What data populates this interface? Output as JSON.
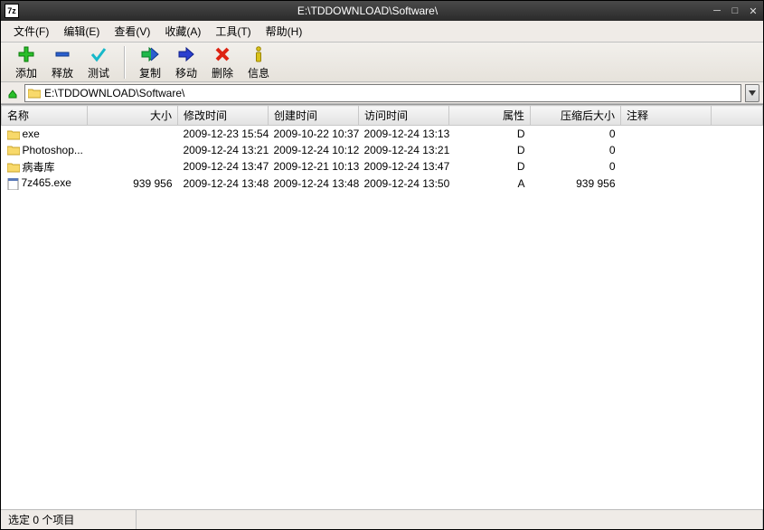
{
  "window": {
    "title": "E:\\TDDOWNLOAD\\Software\\",
    "app_icon": "7z"
  },
  "menu": {
    "file": "文件(F)",
    "edit": "编辑(E)",
    "view": "查看(V)",
    "favorites": "收藏(A)",
    "tools": "工具(T)",
    "help": "帮助(H)"
  },
  "toolbar": {
    "add": "添加",
    "extract": "释放",
    "test": "测试",
    "copy": "复制",
    "move": "移动",
    "delete": "删除",
    "info": "信息"
  },
  "path": {
    "value": "E:\\TDDOWNLOAD\\Software\\"
  },
  "columns": {
    "name": "名称",
    "size": "大小",
    "modified": "修改时间",
    "created": "创建时间",
    "accessed": "访问时间",
    "attributes": "属性",
    "packed": "压缩后大小",
    "comment": "注释"
  },
  "rows": [
    {
      "icon": "folder",
      "name": "exe",
      "size": "",
      "modified": "2009-12-23 15:54",
      "created": "2009-10-22 10:37",
      "accessed": "2009-12-24 13:13",
      "attr": "D",
      "packed": "0"
    },
    {
      "icon": "folder",
      "name": "Photoshop...",
      "size": "",
      "modified": "2009-12-24 13:21",
      "created": "2009-12-24 10:12",
      "accessed": "2009-12-24 13:21",
      "attr": "D",
      "packed": "0"
    },
    {
      "icon": "folder",
      "name": "病毒库",
      "size": "",
      "modified": "2009-12-24 13:47",
      "created": "2009-12-21 10:13",
      "accessed": "2009-12-24 13:47",
      "attr": "D",
      "packed": "0"
    },
    {
      "icon": "file",
      "name": "7z465.exe",
      "size": "939 956",
      "modified": "2009-12-24 13:48",
      "created": "2009-12-24 13:48",
      "accessed": "2009-12-24 13:50",
      "attr": "A",
      "packed": "939 956"
    }
  ],
  "status": {
    "selection": "选定 0 个项目"
  }
}
